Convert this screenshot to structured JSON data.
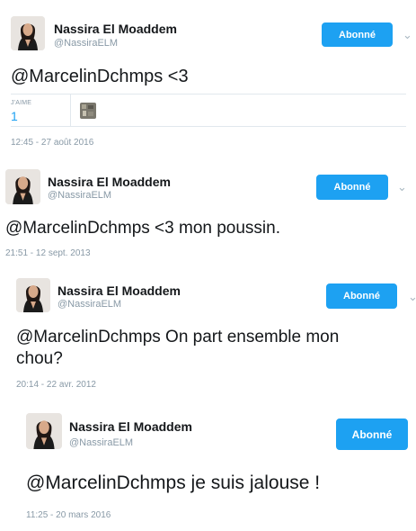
{
  "tweets": [
    {
      "name": "Nassira El Moaddem",
      "handle": "@NassiraELM",
      "follow_label": "Abonné",
      "text": "@MarcelinDchmps <3",
      "likes_label": "J'AIME",
      "likes_count": "1",
      "time": "12:45 - 27 août 2016"
    },
    {
      "name": "Nassira El Moaddem",
      "handle": "@NassiraELM",
      "follow_label": "Abonné",
      "text": "@MarcelinDchmps <3 mon poussin.",
      "time": "21:51 - 12 sept. 2013"
    },
    {
      "name": "Nassira El Moaddem",
      "handle": "@NassiraELM",
      "follow_label": "Abonné",
      "text": "@MarcelinDchmps On part ensemble mon chou?",
      "time": "20:14 - 22 avr. 2012"
    },
    {
      "name": "Nassira El Moaddem",
      "handle": "@NassiraELM",
      "follow_label": "Abonné",
      "text": "@MarcelinDchmps je suis jalouse !",
      "time": "11:25 - 20 mars 2016"
    }
  ],
  "colors": {
    "accent": "#1da1f2",
    "muted": "#8899a6"
  },
  "icons": {
    "chevron": "chevron-down-icon"
  }
}
